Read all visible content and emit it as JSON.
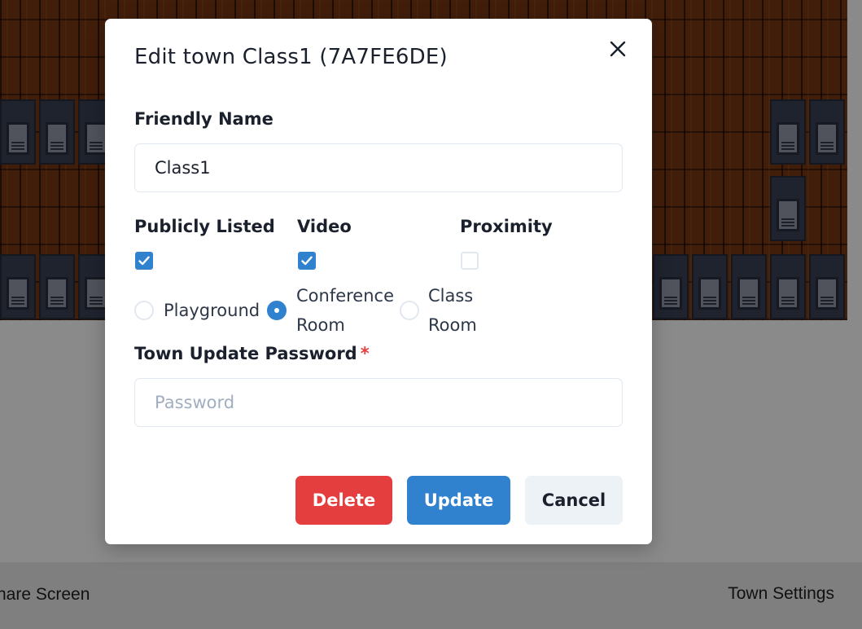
{
  "modal": {
    "title": "Edit town Class1 (7A7FE6DE)",
    "friendly_name": {
      "label": "Friendly Name",
      "value": "Class1"
    },
    "options": {
      "publicly_listed": {
        "label": "Publicly Listed",
        "checked": true
      },
      "video": {
        "label": "Video",
        "checked": true
      },
      "proximity": {
        "label": "Proximity",
        "checked": false
      }
    },
    "room_types": [
      {
        "label": "Playground",
        "selected": false
      },
      {
        "label": "Conference Room",
        "selected": true
      },
      {
        "label": "Class Room",
        "selected": false
      }
    ],
    "password": {
      "label": "Town Update Password",
      "required_marker": "*",
      "placeholder": "Password"
    },
    "buttons": {
      "delete": "Delete",
      "update": "Update",
      "cancel": "Cancel"
    },
    "close_icon": "close-icon"
  },
  "bottom_bar": {
    "share_screen": "Share Screen",
    "town_settings": "Town Settings"
  },
  "colors": {
    "primary": "#3182ce",
    "danger": "#e53e3e",
    "cancel_bg": "#edf2f7",
    "overlay": "#8a8a8a"
  }
}
